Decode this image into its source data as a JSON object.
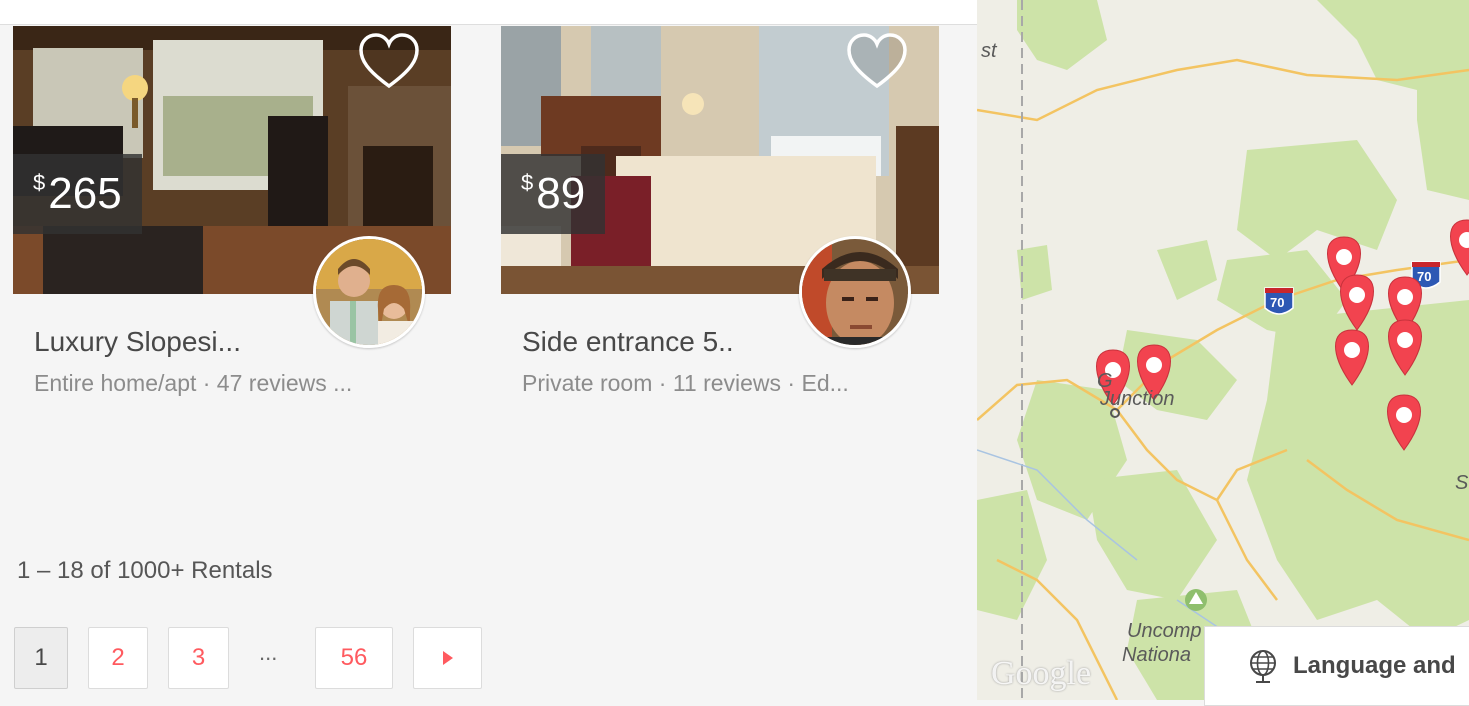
{
  "listings": [
    {
      "price_currency": "$",
      "price": "265",
      "title": "Luxury Slopesi...",
      "meta": "Entire home/apt · 47 reviews ...",
      "favorite_icon": "heart-outline-icon",
      "host_avatar": "host-couple-avatar"
    },
    {
      "price_currency": "$",
      "price": "89",
      "title": "Side entrance 5..",
      "meta": "Private room · 11 reviews · Ed...",
      "favorite_icon": "heart-outline-icon",
      "host_avatar": "host-man-avatar"
    }
  ],
  "results": {
    "count_text": "1 – 18 of 1000+ Rentals"
  },
  "pagination": {
    "pages": [
      "1",
      "2",
      "3",
      "56"
    ],
    "current": "1",
    "ellipsis": "...",
    "next_icon": "triangle-right-icon"
  },
  "map": {
    "labels": {
      "city": "Junction",
      "city_partial": "G",
      "park_line1": "Uncomp",
      "park_line2": "Nationa",
      "edge_left": "st",
      "edge_right": "S"
    },
    "highway_shields": [
      "70",
      "70"
    ],
    "google_logo": "Google",
    "marker_color": "#f2434f"
  },
  "language_button": {
    "label": "Language and",
    "icon": "globe-icon"
  },
  "colors": {
    "accent": "#ff5a5f",
    "map_green": "#cde3a8",
    "map_road": "#f3c462"
  }
}
